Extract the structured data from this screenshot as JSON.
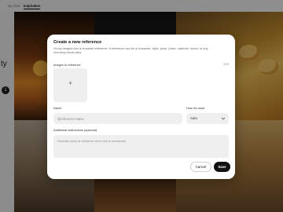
{
  "nav": {
    "tabs": [
      {
        "label": "My work"
      },
      {
        "label": "Inspiration"
      }
    ]
  },
  "background": {
    "left_text": "ty",
    "left_badge": "1"
  },
  "modal": {
    "title": "Create a new reference",
    "description": "Group images into a reusable reference. A reference can be a character, style, pose, place, material, mood, or any recurring visual idea.",
    "images_label": "Images to reference",
    "image_count": "0/20",
    "add_image_symbol": "+",
    "name_label": "Name",
    "name_placeholder": "@reference-name",
    "name_value": "",
    "how_used_label": "How it's used",
    "how_used_value": "Auto",
    "extra_label": "Additional instructions (optional)",
    "extra_placeholder": "Describe what to reference when this is mentioned",
    "cancel_label": "Cancel",
    "save_label": "Save"
  },
  "colors": {
    "primary_button": "#111111",
    "field_background": "#efefef",
    "overlay": "rgba(0,0,0,0.42)"
  },
  "icons": {
    "dropdown": "chevron-down-icon",
    "add": "plus-icon"
  }
}
